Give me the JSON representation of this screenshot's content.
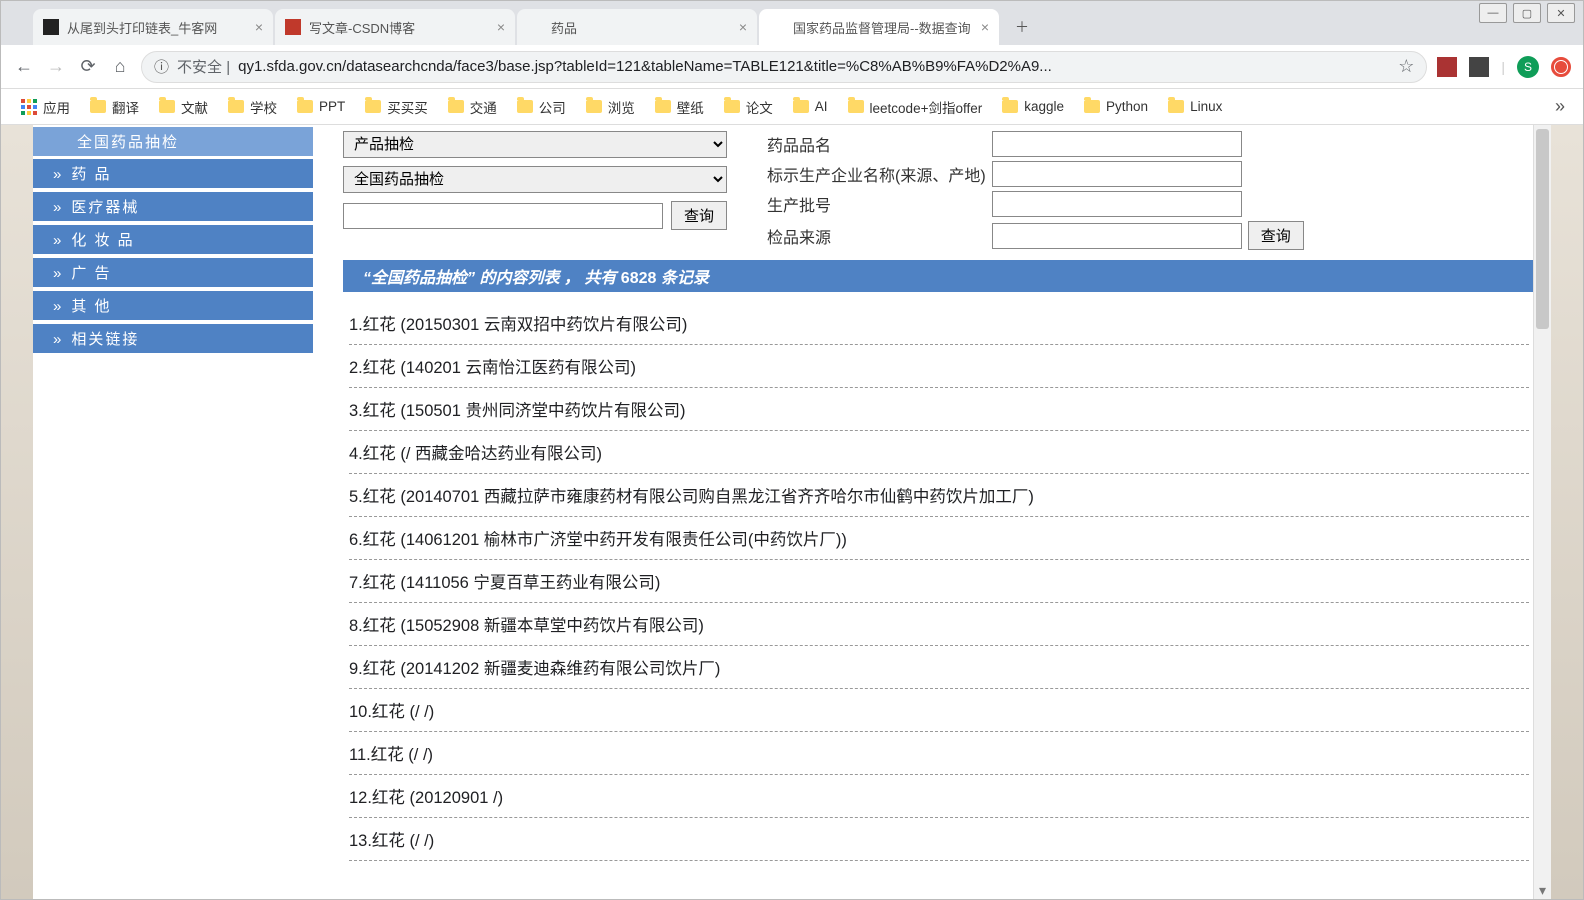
{
  "window": {
    "tabs": [
      {
        "title": "从尾到头打印链表_牛客网",
        "favicon": "dark"
      },
      {
        "title": "写文章-CSDN博客",
        "favicon": "red"
      },
      {
        "title": "药品",
        "favicon": "page"
      },
      {
        "title": "国家药品监督管理局--数据查询",
        "favicon": "page",
        "active": true
      }
    ]
  },
  "nav": {
    "insecure_label": "不安全",
    "url": "qy1.sfda.gov.cn/datasearchcnda/face3/base.jsp?tableId=121&tableName=TABLE121&title=%C8%AB%B9%FA%D2%A9...",
    "avatar_initial": "S"
  },
  "bookmarks": [
    "应用",
    "翻译",
    "文献",
    "学校",
    "PPT",
    "买买买",
    "交通",
    "公司",
    "浏览",
    "壁纸",
    "论文",
    "AI",
    "leetcode+剑指offer",
    "kaggle",
    "Python",
    "Linux"
  ],
  "sidebar": {
    "top": "全国药品抽检",
    "items": [
      "药     品",
      "医疗器械",
      "化 妆 品",
      "广         告",
      "其         他",
      "相关链接"
    ]
  },
  "filters": {
    "sel1": "产品抽检",
    "sel2": "全国药品抽检",
    "btn_search": "查询",
    "fields": {
      "f1": "药品品名",
      "f2": "标示生产企业名称(来源、产地)",
      "f3": "生产批号",
      "f4": "检品来源"
    }
  },
  "banner": {
    "prefix": "“全国药品抽检” 的内容列表  ，  共有 ",
    "count": "6828",
    "suffix": " 条记录"
  },
  "results": [
    "1.红花 (20150301 云南双招中药饮片有限公司)",
    "2.红花 (140201 云南怡江医药有限公司)",
    "3.红花 (150501 贵州同济堂中药饮片有限公司)",
    "4.红花 (/ 西藏金哈达药业有限公司)",
    "5.红花 (20140701 西藏拉萨市雍康药材有限公司购自黑龙江省齐齐哈尔市仙鹤中药饮片加工厂)",
    "6.红花 (14061201 榆林市广济堂中药开发有限责任公司(中药饮片厂))",
    "7.红花 (1411056 宁夏百草王药业有限公司)",
    "8.红花 (15052908 新疆本草堂中药饮片有限公司)",
    "9.红花 (20141202 新疆麦迪森维药有限公司饮片厂)",
    "10.红花 (/ /)",
    "11.红花 (/ /)",
    "12.红花 (20120901 /)",
    "13.红花 (/ /)"
  ]
}
